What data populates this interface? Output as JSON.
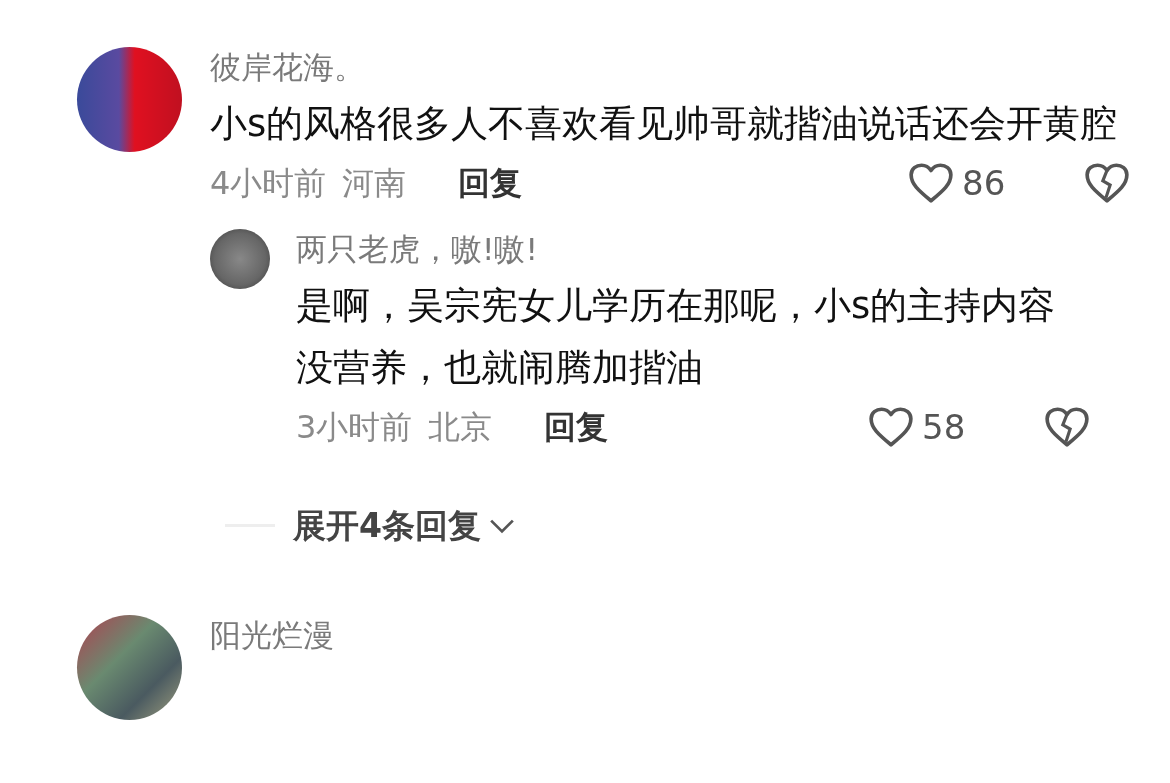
{
  "comments": [
    {
      "user": "彼岸花海。",
      "text": "小s的风格很多人不喜欢看见帅哥就揩油说话还会开黄腔",
      "time": "4小时前",
      "location": "河南",
      "reply_label": "回复",
      "likes": "86",
      "replies": [
        {
          "user": "两只老虎，嗷!嗷!",
          "text": "是啊，吴宗宪女儿学历在那呢，小s的主持内容没营养，也就闹腾加揩油",
          "time": "3小时前",
          "location": "北京",
          "reply_label": "回复",
          "likes": "58"
        }
      ],
      "expand_label": "展开4条回复"
    },
    {
      "user": "阳光烂漫"
    }
  ]
}
